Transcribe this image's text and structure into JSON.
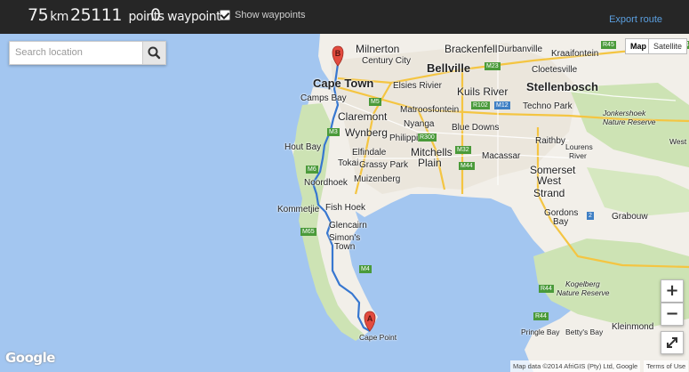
{
  "header": {
    "distance_value": "75",
    "distance_unit": "km",
    "points_value": "25111",
    "points_label": "points",
    "waypoints_value": "0",
    "waypoints_label": "waypoints",
    "show_waypoints_label": "Show waypoints",
    "show_waypoints_checked": true,
    "export_label": "Export route"
  },
  "search": {
    "placeholder": "Search location"
  },
  "map_type": {
    "map_label": "Map",
    "satellite_label": "Satellite",
    "selected": "Map"
  },
  "zoom": {
    "in_label": "+",
    "out_label": "−"
  },
  "markers": {
    "start": "A",
    "end": "B"
  },
  "places": {
    "cape_town": "Cape Town",
    "milnerton": "Milnerton",
    "brackenfell": "Brackenfell",
    "century_city": "Century City",
    "bellville": "Bellville",
    "durbanville": "Durbanville",
    "kraaifontein": "Kraaifontein",
    "cloetesville": "Cloetesville",
    "stellenbosch": "Stellenbosch",
    "elsies_rivier": "Elsies Rivier",
    "kuils_river": "Kuils River",
    "camps_bay": "Camps Bay",
    "techno_park": "Techno Park",
    "matroosfontein": "Matroosfontein",
    "claremont": "Claremont",
    "nyanga": "Nyanga",
    "blue_downs": "Blue Downs",
    "jonkershoek": "Jonkershoek",
    "nature_reserve": "Nature Reserve",
    "wynberg": "Wynberg",
    "philippi": "Philippi",
    "raithby": "Raithby",
    "hout_bay": "Hout Bay",
    "elfindale": "Elfindale",
    "mitchells_plain_1": "Mitchells",
    "mitchells_plain_2": "Plain",
    "macassar": "Macassar",
    "lourens_river_1": "Lourens",
    "lourens_river_2": "River",
    "tokai": "Tokai",
    "grassy_park": "Grassy Park",
    "somerset_west_1": "Somerset",
    "somerset_west_2": "West",
    "noordhoek": "Noordhoek",
    "muizenberg": "Muizenberg",
    "strand": "Strand",
    "kommetjie": "Kommetjie",
    "fish_hoek": "Fish Hoek",
    "gordons_bay_1": "Gordons",
    "gordons_bay_2": "Bay",
    "grabouw": "Grabouw",
    "glencairn": "Glencairn",
    "simons_town_1": "Simon's",
    "simons_town_2": "Town",
    "kogelberg_1": "Kogelberg",
    "kogelberg_2": "Nature Reserve",
    "kleinmond": "Kleinmond",
    "pringle_bay": "Pringle Bay",
    "bettys_bay": "Betty's Bay",
    "cape_point": "Cape Point",
    "west": "West"
  },
  "roads": {
    "r45": "R45",
    "r44": "R44",
    "m23": "M23",
    "r102": "R102",
    "m12": "M12",
    "r300": "R300",
    "m5": "M5",
    "m3": "M3",
    "m32": "M32",
    "m44": "M44",
    "m6": "M6",
    "m65": "M65",
    "m4": "M4",
    "n2": "2"
  },
  "footer": {
    "google": "Google",
    "attribution": "Map data ©2014 AfriGIS (Pty) Ltd, Google",
    "terms": "Terms of Use"
  },
  "colors": {
    "water": "#a3c6f0",
    "land": "#f2efe9",
    "park": "#cde3b4",
    "urban": "#e8e4dc",
    "route": "#3777d0",
    "marker": "#e24b3f",
    "topbar": "#262626",
    "export_link": "#5b9fe0"
  }
}
